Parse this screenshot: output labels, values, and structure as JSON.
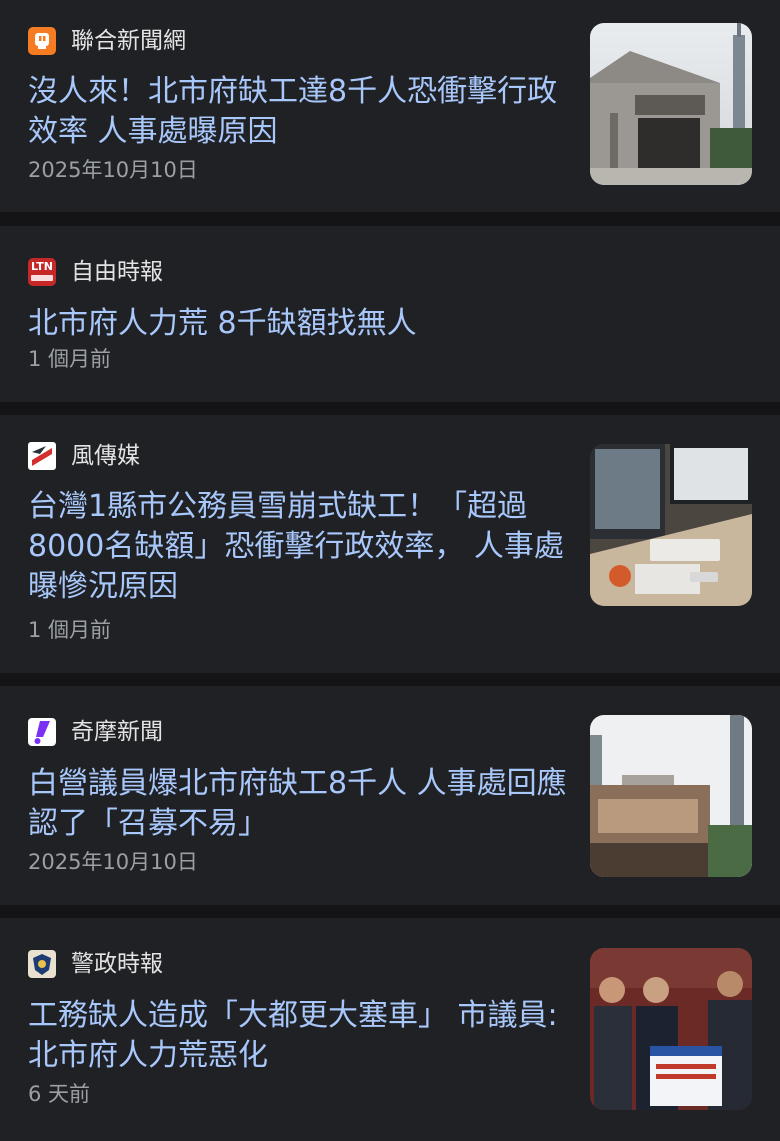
{
  "articles": [
    {
      "source": "聯合新聞網",
      "logo": "udn-logo-icon",
      "title": "沒人來！北市府缺工達8千人恐衝擊行政效率 人事處曝原因",
      "time": "2025年10月10日",
      "thumbnail": "city-hall-building-image"
    },
    {
      "source": "自由時報",
      "logo": "ltn-logo-icon",
      "logo_text": "LTN",
      "title": "北市府人力荒 8千缺額找無人",
      "time": "1 個月前"
    },
    {
      "source": "風傳媒",
      "logo": "storm-media-logo-icon",
      "title": "台灣1縣市公務員雪崩式缺工！「超過8000名缺額」恐衝擊行政效率， 人事處曝慘況原因",
      "time": "1 個月前",
      "thumbnail": "office-desk-image"
    },
    {
      "source": "奇摩新聞",
      "logo": "yahoo-news-logo-icon",
      "title": "白營議員爆北市府缺工8千人 人事處回應認了「召募不易」",
      "time": "2025年10月10日",
      "thumbnail": "city-hall-taipei101-image"
    },
    {
      "source": "警政時報",
      "logo": "police-times-logo-icon",
      "title": "工務缺人造成「大都更大塞車」 市議員:北市府人力荒惡化",
      "time": "6 天前",
      "thumbnail": "council-meeting-image"
    }
  ],
  "colors": {
    "background": "#141416",
    "card": "#202124",
    "title": "#a8c7fa",
    "source": "#e3e3e3",
    "meta": "#9aa0a6"
  }
}
